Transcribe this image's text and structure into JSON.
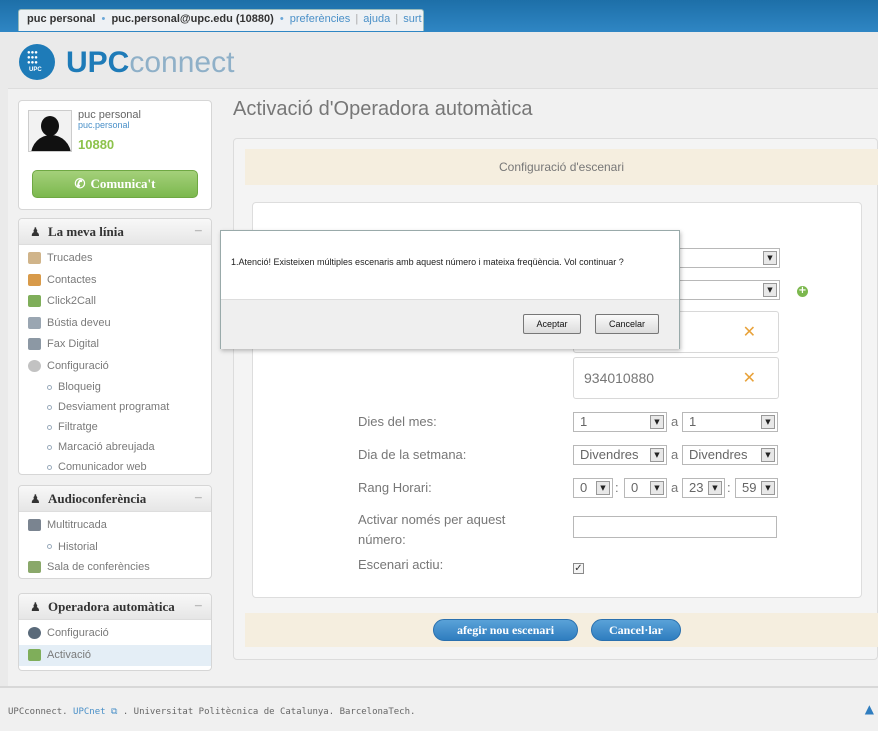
{
  "topbar": {
    "user_name": "puc personal",
    "user_email": "puc.personal@upc.edu (10880)",
    "links": [
      "preferències",
      "ajuda",
      "surt"
    ]
  },
  "logo": {
    "small": "UPC",
    "bold": "UPC",
    "light": "connect"
  },
  "profile": {
    "name": "puc personal",
    "username": "puc.personal",
    "extension": "10880",
    "call_button": "Comunica't"
  },
  "sidebar": {
    "linia": {
      "title": "La meva línia",
      "items": [
        "Trucades",
        "Contactes",
        "Click2Call",
        "Bústia deveu",
        "Fax Digital",
        "Configuració"
      ],
      "subitems": [
        "Bloqueig",
        "Desviament programat",
        "Filtratge",
        "Marcació abreujada",
        "Comunicador web"
      ]
    },
    "audio": {
      "title": "Audioconferència",
      "items": [
        "Multitrucada",
        "Historial",
        "Sala de conferències"
      ]
    },
    "operadora": {
      "title": "Operadora automàtica",
      "items": [
        "Configuració",
        "Activació"
      ]
    }
  },
  "main": {
    "title": "Activació d'Operadora automàtica",
    "section_title": "Configuració d'escenari",
    "number": "934010880",
    "labels": {
      "dies_mes": "Dies del mes:",
      "dia_setmana": "Dia de la setmana:",
      "rang": "Rang Horari:",
      "activar": "Activar només per aquest número:",
      "actiu": "Escenari actiu:"
    },
    "a": "a",
    "colon": ":",
    "dies_from": "1",
    "dies_to": "1",
    "setmana_from": "Divendres",
    "setmana_to": "Divendres",
    "hora_from_h": "0",
    "hora_from_m": "0",
    "hora_to_h": "23",
    "hora_to_m": "59",
    "check_mark": "✓",
    "btn_add": "afegir nou escenari",
    "btn_cancel": "Cancel·lar"
  },
  "dialog": {
    "message": "1.Atenció! Existeixen múltiples escenaris amb aquest número i mateixa freqüència. Vol continuar ?",
    "accept": "Aceptar",
    "cancel": "Cancelar"
  },
  "footer": {
    "prefix": "UPCconnect.",
    "link": "UPCnet",
    "suffix": ". Universitat Politècnica de Catalunya. BarcelonaTech."
  },
  "colors": {
    "brand_blue": "#1e7bb8",
    "green": "#7cb84e",
    "orange_x": "#e8a23a"
  }
}
